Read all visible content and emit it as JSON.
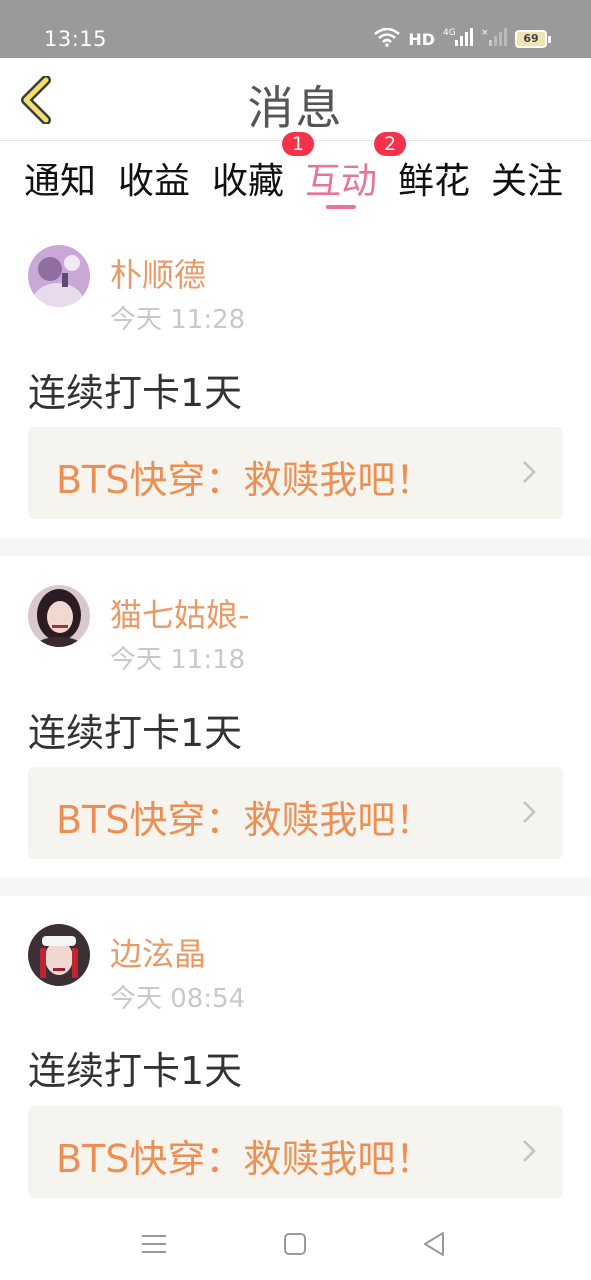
{
  "status_bar": {
    "time": "13:15",
    "network_label": "HD",
    "signal_label": "4G",
    "battery": "69"
  },
  "header": {
    "title": "消息",
    "back_icon": "chevron-left-icon"
  },
  "tabs": [
    {
      "label": "通知",
      "active": false,
      "badge": ""
    },
    {
      "label": "收益",
      "active": false,
      "badge": ""
    },
    {
      "label": "收藏",
      "active": false,
      "badge": "1"
    },
    {
      "label": "互动",
      "active": true,
      "badge": "2"
    },
    {
      "label": "鲜花",
      "active": false,
      "badge": ""
    },
    {
      "label": "关注",
      "active": false,
      "badge": ""
    }
  ],
  "messages": [
    {
      "username": "朴顺德",
      "time": "今天 11:28",
      "content": "连续打卡1天",
      "book": "BTS快穿：救赎我吧！"
    },
    {
      "username": "猫七姑娘-",
      "time": "今天 11:18",
      "content": "连续打卡1天",
      "book": "BTS快穿：救赎我吧！"
    },
    {
      "username": "边泫晶",
      "time": "今天 08:54",
      "content": "连续打卡1天",
      "book": "BTS快穿：救赎我吧！"
    }
  ],
  "colors": {
    "accent": "#e8749b",
    "username": "#e99a66",
    "book_title": "#ec8f55",
    "badge": "#f2334a",
    "book_bg": "#f5f4ee"
  },
  "nav_bar": [
    "menu-icon",
    "home-square-icon",
    "back-triangle-icon"
  ]
}
